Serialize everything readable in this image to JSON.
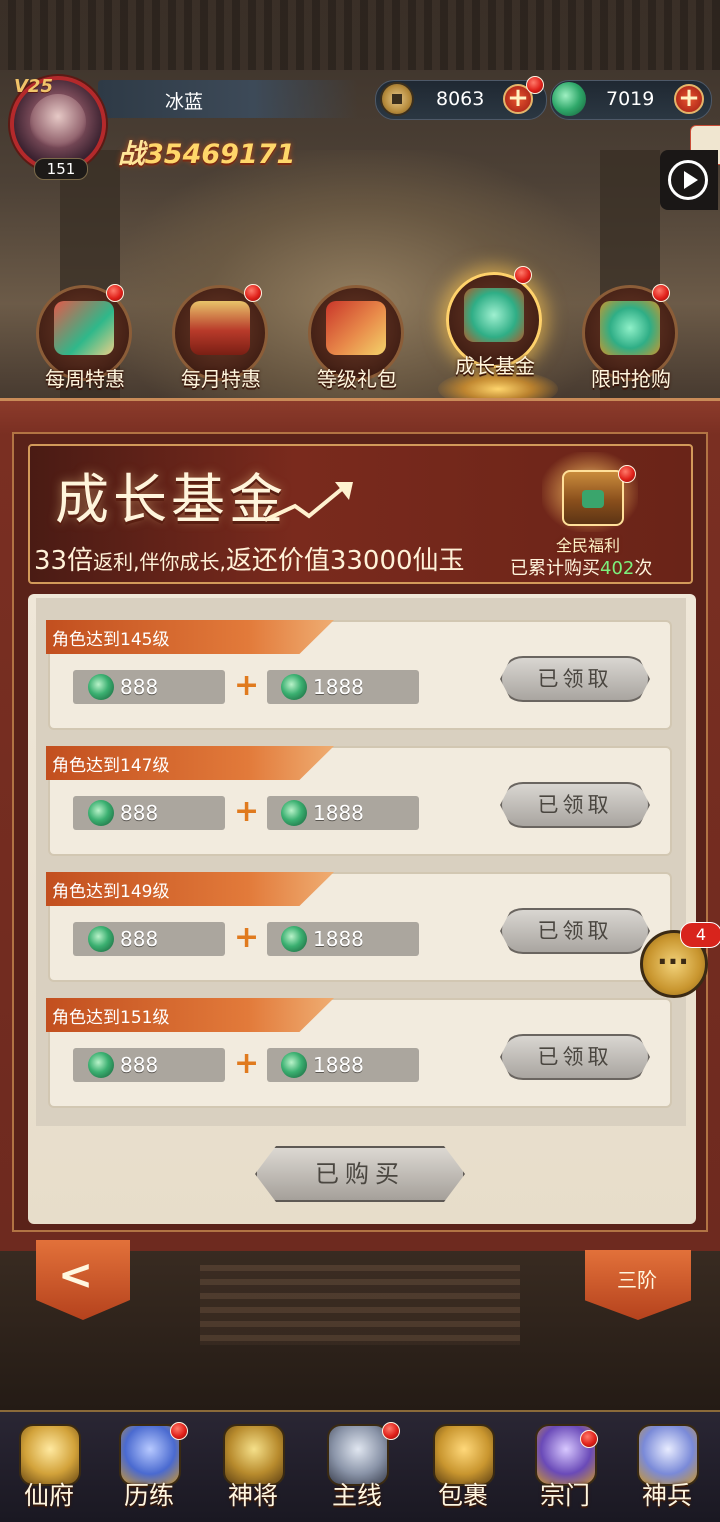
{
  "player": {
    "vip": "V25",
    "name": "冰蓝",
    "level": "151",
    "power_prefix": "战",
    "power": "35469171"
  },
  "currency": {
    "coin": "8063",
    "jade": "7019",
    "add_symbol": "+"
  },
  "tabs": [
    {
      "label": "每周特惠",
      "icon": "gift-box-icon",
      "has_dot": true
    },
    {
      "label": "每月特惠",
      "icon": "pavilion-icon",
      "has_dot": true
    },
    {
      "label": "等级礼包",
      "icon": "present-arrow-icon",
      "has_dot": false
    },
    {
      "label": "成长基金",
      "icon": "jade-chest-icon",
      "has_dot": true,
      "active": true
    },
    {
      "label": "限时抢购",
      "icon": "jade-pot-icon",
      "has_dot": true
    }
  ],
  "banner": {
    "title": "成长基金",
    "sub_big1": "33倍",
    "sub_small1": "返利,伴你成长,",
    "sub_big2": "返还价值33000仙玉",
    "welfare_label": "全民福利",
    "count_prefix": "已累计购买",
    "count_value": "402",
    "count_suffix": "次"
  },
  "rewards": [
    {
      "condition": "角色达到145级",
      "reward1": "888",
      "reward2": "1888",
      "status": "已领取"
    },
    {
      "condition": "角色达到147级",
      "reward1": "888",
      "reward2": "1888",
      "status": "已领取"
    },
    {
      "condition": "角色达到149级",
      "reward1": "888",
      "reward2": "1888",
      "status": "已领取"
    },
    {
      "condition": "角色达到151级",
      "reward1": "888",
      "reward2": "1888",
      "status": "已领取"
    }
  ],
  "plus_sign": "+",
  "bought_label": "已购买",
  "chat_badge": "4",
  "back_label": "<",
  "tier_label": "三阶",
  "bottom_nav": [
    {
      "label": "仙府",
      "icon": "immortal-house-icon"
    },
    {
      "label": "历练",
      "icon": "training-icon"
    },
    {
      "label": "神将",
      "icon": "general-icon"
    },
    {
      "label": "主线",
      "icon": "crossed-swords-icon"
    },
    {
      "label": "包裹",
      "icon": "bag-icon"
    },
    {
      "label": "宗门",
      "icon": "sect-icon"
    },
    {
      "label": "神兵",
      "icon": "divine-weapon-icon"
    }
  ],
  "colors": {
    "accent_gold": "#ffd76a",
    "panel_red": "#7a2f22",
    "reward_tag": "#e27a3a",
    "count_green": "#7cf07c"
  }
}
